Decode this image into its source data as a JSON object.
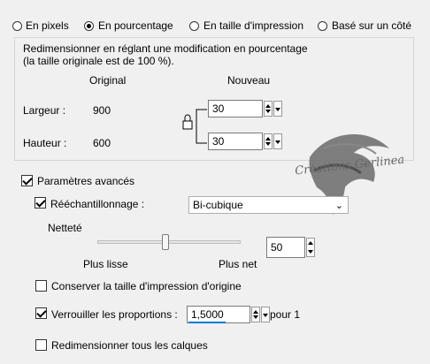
{
  "modes": {
    "pixels": "En pixels",
    "percent": "En pourcentage",
    "print_size": "En taille d'impression",
    "one_side": "Basé sur un côté"
  },
  "info": {
    "line1": "Redimensionner en réglant une modification en pourcentage",
    "line2": "(la taille originale est de 100 %)."
  },
  "columns": {
    "original": "Original",
    "nouveau": "Nouveau"
  },
  "width": {
    "label": "Largeur :",
    "original": "900",
    "value": "30"
  },
  "height": {
    "label": "Hauteur :",
    "original": "600",
    "value": "30"
  },
  "advanced": {
    "label": "Paramètres avancés",
    "resample_label": "Rééchantillonnage :",
    "resample_value": "Bi-cubique",
    "sharpness_label": "Netteté",
    "slider_min": "Plus lisse",
    "slider_max": "Plus net",
    "sharpness_value": "50",
    "sharpness_level": 0.5,
    "keep_print": "Conserver la taille d'impression d'origine",
    "lock_label": "Verrouiller les proportions :",
    "lock_value": "1,5000",
    "lock_suffix": "pour 1",
    "resize_layers": "Redimensionner tous les calques"
  },
  "watermark": {
    "text": "Créations Gerlinea",
    "icon": "unicorn-watermark"
  },
  "colors": {
    "accent": "#0078d7"
  }
}
